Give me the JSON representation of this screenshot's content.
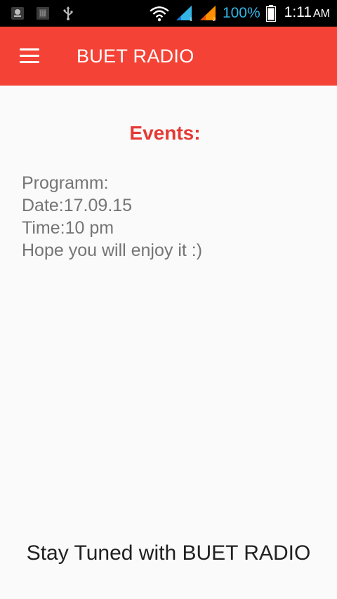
{
  "status_bar": {
    "icons_left": [
      "notification-icon",
      "sim-card-icon",
      "usb-icon"
    ],
    "icons_right": [
      "wifi-icon",
      "signal-sim1-icon",
      "signal-sim2-icon",
      "battery-icon"
    ],
    "battery_percent": "100%",
    "time": "1:11",
    "ampm": "AM",
    "battery_color": "#33b5e5"
  },
  "app_bar": {
    "menu_icon": "hamburger-menu-icon",
    "title": "BUET RADIO",
    "color": "#f44336"
  },
  "main": {
    "heading": "Events:",
    "heading_color": "#e53935",
    "details": [
      "Programm:",
      "Date:17.09.15",
      "Time:10 pm",
      "Hope you will enjoy it :)"
    ]
  },
  "footer": {
    "text": "Stay Tuned with BUET RADIO"
  }
}
